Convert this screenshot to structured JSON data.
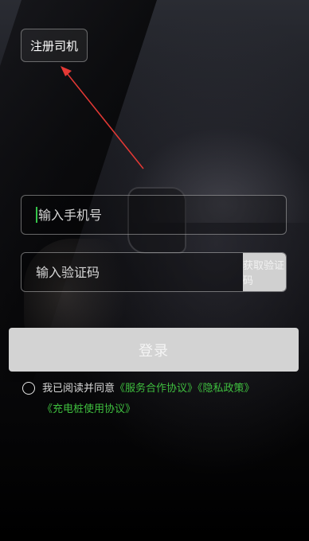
{
  "header": {
    "register_label": "注册司机"
  },
  "form": {
    "phone_placeholder": "输入手机号",
    "code_placeholder": "输入验证码",
    "get_code_label": "获取验证码",
    "login_label": "登录"
  },
  "agreement": {
    "prefix": "我已阅读并同意",
    "link_service": "《服务合作协议》",
    "link_privacy": "《隐私政策》",
    "link_charging": "《充电桩使用协议》"
  },
  "colors": {
    "accent_green": "#3fbf3f",
    "annotation_arrow": "#e53935",
    "disabled_button": "#d3d3d3"
  }
}
